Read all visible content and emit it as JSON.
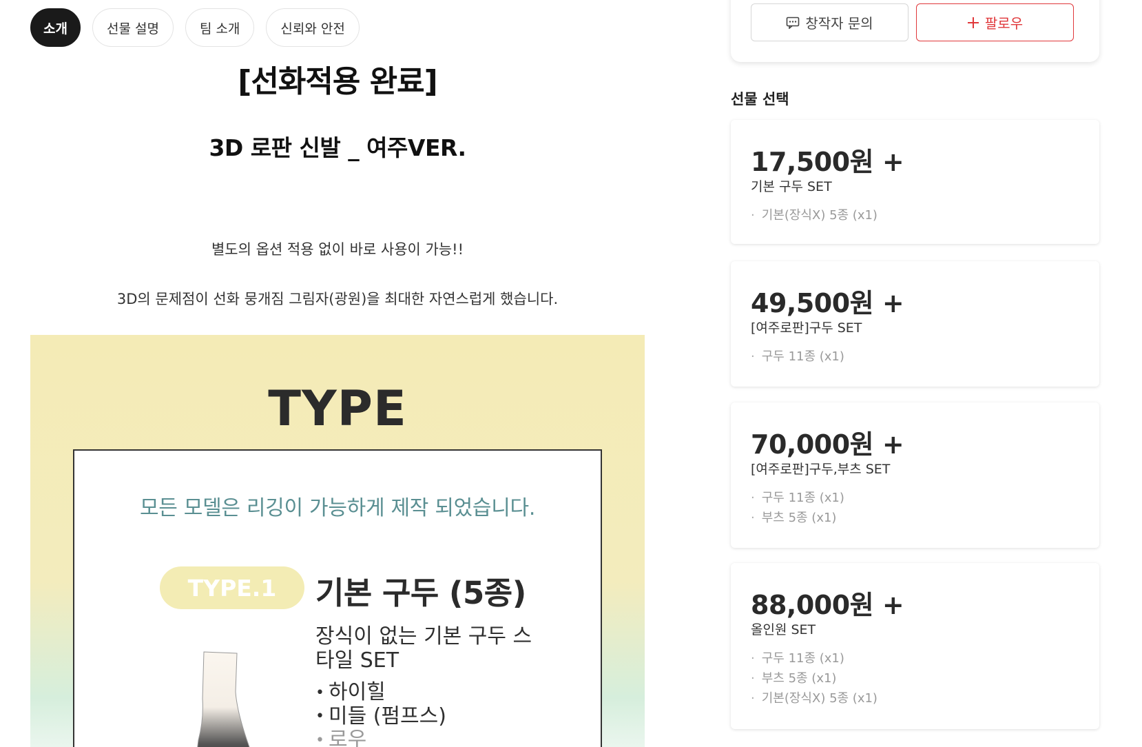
{
  "tabs": [
    {
      "label": "소개",
      "active": true
    },
    {
      "label": "선물 설명",
      "active": false
    },
    {
      "label": "팀 소개",
      "active": false
    },
    {
      "label": "신뢰와 안전",
      "active": false
    }
  ],
  "story": {
    "title": "[선화적용 완료]",
    "subtitle": "3D 로판 신발 _ 여주VER.",
    "desc1": "별도의 옵션 적용 없이 바로 사용이 가능!!",
    "desc2": "3D의 문제점이 선화 뭉개짐 그림자(광원)을 최대한 자연스럽게 했습니다."
  },
  "banner": {
    "heading": "TYPE",
    "note": "모든 모델은 리깅이 가능하게 제작 되었습니다.",
    "pill": "TYPE.1",
    "type_name": "기본 구두 (5종)",
    "type_desc": "장식이 없는 기본 구두 스타일 SET",
    "list": [
      "하이힐",
      "미들 (펌프스)",
      "로우"
    ]
  },
  "creator": {
    "inquiry_label": "창작자 문의",
    "follow_label": "팔로우",
    "accent": "#e0373a"
  },
  "gift_section": {
    "label": "선물 선택",
    "gifts": [
      {
        "price": "17,500원 +",
        "name": "기본 구두 SET",
        "items": [
          "기본(장식X) 5종 (x1)"
        ]
      },
      {
        "price": "49,500원 +",
        "name": "[여주로판]구두 SET",
        "items": [
          "구두 11종 (x1)"
        ]
      },
      {
        "price": "70,000원 +",
        "name": "[여주로판]구두,부츠 SET",
        "items": [
          "구두 11종 (x1)",
          "부츠 5종 (x1)"
        ]
      },
      {
        "price": "88,000원 +",
        "name": "올인원 SET",
        "items": [
          "구두 11종 (x1)",
          "부츠 5종 (x1)",
          "기본(장식X) 5종 (x1)"
        ]
      }
    ]
  }
}
